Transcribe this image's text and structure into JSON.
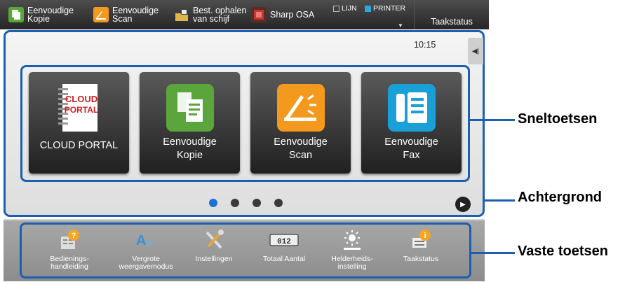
{
  "topbar": {
    "items": [
      {
        "label": "Eenvoudige\nKopie",
        "icon": "copy-icon",
        "color": "#5aa63c"
      },
      {
        "label": "Eenvoudige\nScan",
        "icon": "scan-icon",
        "color": "#f39a1e"
      },
      {
        "label": "Best. ophalen\nvan schijf",
        "icon": "folder-icon",
        "color": "#e0b64a"
      },
      {
        "label": "Sharp OSA",
        "icon": "osa-icon",
        "color": "#c0392b"
      }
    ],
    "status_line": "LIJN",
    "status_printer": "PRINTER",
    "job_status": "Taakstatus"
  },
  "main": {
    "time": "10:15",
    "shortcuts": [
      {
        "label": "CLOUD PORTAL",
        "icon": "cloud-portal-icon",
        "icon_text": "CLOUD\nPORTAL"
      },
      {
        "label": "Eenvoudige\nKopie",
        "icon": "copy-icon"
      },
      {
        "label": "Eenvoudige\nScan",
        "icon": "scan-icon"
      },
      {
        "label": "Eenvoudige\nFax",
        "icon": "fax-icon"
      }
    ],
    "page_count": 4,
    "active_page": 1
  },
  "fixed_keys": [
    {
      "label": "Bedienings-\nhandleiding",
      "icon": "manual-icon"
    },
    {
      "label": "Vergrote\nweergavemodus",
      "icon": "magnify-text-icon"
    },
    {
      "label": "Instellingen",
      "icon": "tools-icon"
    },
    {
      "label": "Totaal Aantal",
      "icon": "counter-icon",
      "counter_text": "012"
    },
    {
      "label": "Helderheids-\ninstelling",
      "icon": "brightness-icon"
    },
    {
      "label": "Taakstatus",
      "icon": "job-status-icon"
    }
  ],
  "callouts": {
    "shortcuts": "Sneltoetsen",
    "background": "Achtergrond",
    "fixed_keys": "Vaste toetsen"
  },
  "colors": {
    "accent_blue": "#1b5fae",
    "page_dot_active": "#1f6fd6",
    "tile_dark": "#2b2b2b"
  }
}
